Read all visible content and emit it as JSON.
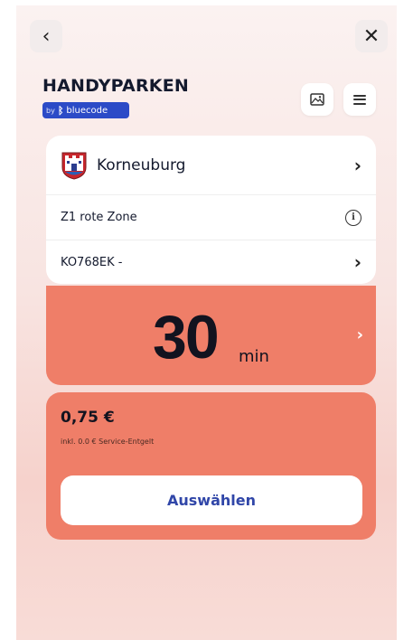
{
  "header": {
    "back_icon": "chevron-left-icon",
    "close_icon": "close-icon",
    "title": "HANDYPARKEN",
    "brand": {
      "by": "by",
      "name": "bluecode"
    },
    "actions": [
      "image-icon",
      "menu-icon"
    ]
  },
  "card": {
    "city": {
      "name": "Korneuburg",
      "crest_icon": "city-crest-icon"
    },
    "zone": {
      "label": "Z1 rote Zone",
      "icon": "info-icon",
      "icon_glyph": "i"
    },
    "plate": {
      "label": "KO768EK -"
    },
    "chevron": "›"
  },
  "duration": {
    "value": "30",
    "unit": "min"
  },
  "pricing": {
    "price": "0,75 €",
    "note": "inkl. 0.0 € Service-Entgelt",
    "select_label": "Auswählen"
  },
  "colors": {
    "accent": "#ef7e68",
    "primary_text": "#141a2e",
    "button_text": "#3046a8",
    "brand": "#2b4bc7"
  }
}
